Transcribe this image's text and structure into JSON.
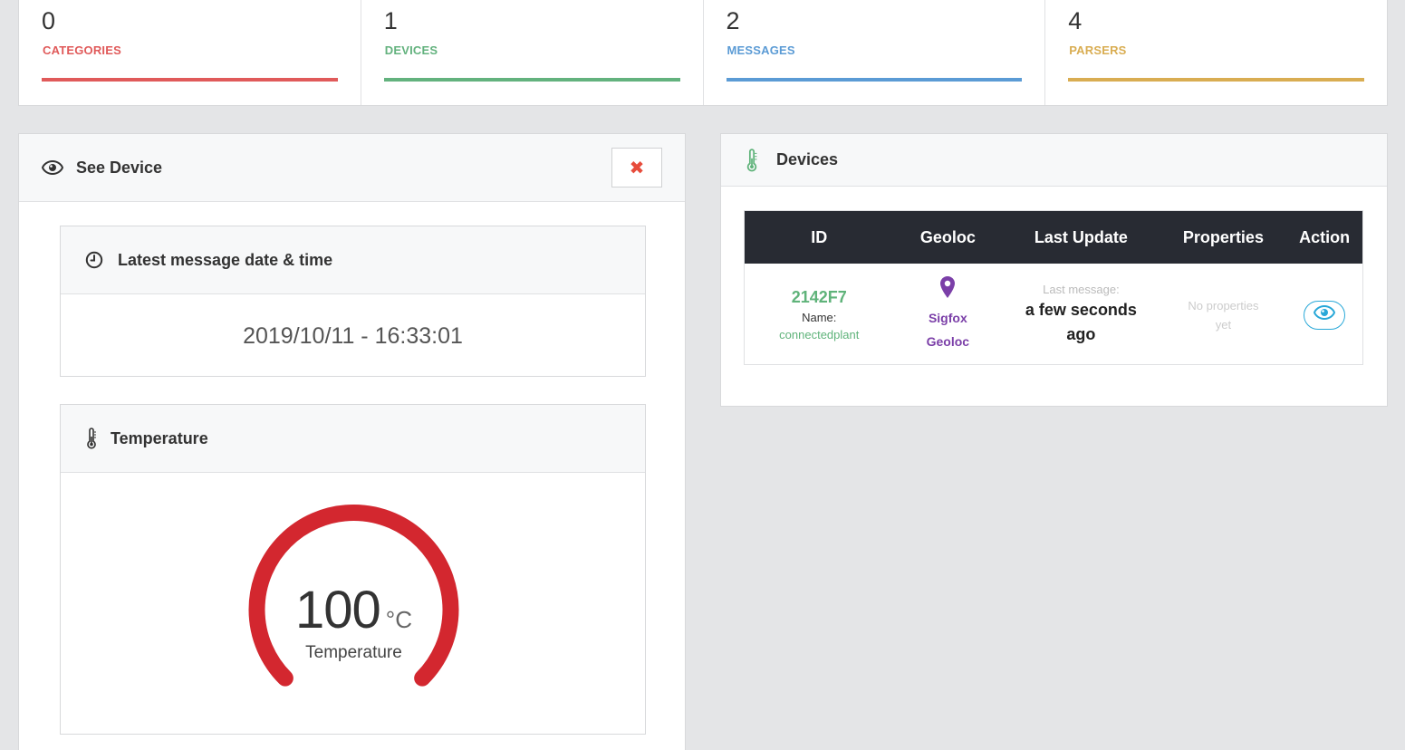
{
  "stats": [
    {
      "value": "0",
      "label": "CATEGORIES",
      "color": "#e05a5a"
    },
    {
      "value": "1",
      "label": "DEVICES",
      "color": "#63b27e"
    },
    {
      "value": "2",
      "label": "MESSAGES",
      "color": "#5b9bd5"
    },
    {
      "value": "4",
      "label": "PARSERS",
      "color": "#d9ad52"
    }
  ],
  "see_device": {
    "title": "See Device",
    "close_glyph": "✖",
    "latest": {
      "title": "Latest message date & time",
      "value": "2019/10/11 - 16:33:01"
    },
    "temperature": {
      "title": "Temperature",
      "value": "100",
      "unit": "°C",
      "label": "Temperature",
      "level": 1.0,
      "gauge_color": "#d3272f"
    }
  },
  "devices": {
    "title": "Devices",
    "columns": [
      "ID",
      "Geoloc",
      "Last Update",
      "Properties",
      "Action"
    ],
    "rows": [
      {
        "id": "2142F7",
        "name_label": "Name:",
        "name": "connectedplant",
        "geoloc_line1": "Sigfox",
        "geoloc_line2": "Geoloc",
        "last_label": "Last message:",
        "last_line1": "a few seconds",
        "last_line2": "ago",
        "props_line1": "No properties",
        "props_line2": "yet"
      }
    ]
  },
  "icons": {
    "see_device": "eye-icon",
    "latest": "clock-icon",
    "temperature": "thermometer-icon",
    "devices": "thermometer-icon",
    "geoloc": "map-marker-icon",
    "action": "eye-icon",
    "close": "close-icon"
  }
}
